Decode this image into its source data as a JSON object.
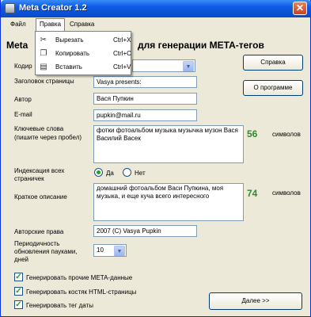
{
  "window": {
    "title": "Meta Creator 1.2",
    "close_glyph": "✕"
  },
  "menubar": {
    "items": [
      "Файл",
      "Правка",
      "Справка"
    ]
  },
  "edit_menu": {
    "items": [
      {
        "label": "Вырезать",
        "shortcut": "Ctrl+X",
        "icon": "scissors-icon"
      },
      {
        "label": "Копировать",
        "shortcut": "Ctrl+C",
        "icon": "copy-icon"
      },
      {
        "label": "Вставить",
        "shortcut": "Ctrl+V",
        "icon": "paste-icon"
      }
    ]
  },
  "heading": {
    "left": "Meta",
    "right": "для генерации META-тегов"
  },
  "side_buttons": {
    "help": "Справка",
    "about": "О программе",
    "next": "Далее >>"
  },
  "form": {
    "encoding": {
      "label": "Кодир"
    },
    "title": {
      "label": "Заголовок страницы",
      "value": "Vasya presents:"
    },
    "author": {
      "label": "Автор",
      "value": "Вася Пупкин"
    },
    "email": {
      "label": "E-mail",
      "value": "pupkin@mail.ru"
    },
    "keywords": {
      "label_line1": "Ключевые слова",
      "label_line2": "(пишите через пробел)",
      "value": "фотки фотоальбом музыка музычка музон Вася Василий Васек",
      "count": "56",
      "unit": "символов"
    },
    "indexing": {
      "label_line1": "Индексация всех",
      "label_line2": "страничек",
      "yes": "Да",
      "no": "Нет",
      "selected": "Да"
    },
    "description": {
      "label": "Краткое описание",
      "value": "домашний фотоальбом Васи Пупкина, моя музыка, и еще куча всего интересного",
      "count": "74",
      "unit": "символов"
    },
    "copyright": {
      "label": "Авторские права",
      "value": "2007 (C) Vasya Pupkin"
    },
    "revisit": {
      "label_line1": "Периодичность",
      "label_line2": "обновления пауками,",
      "label_line3": "дней",
      "value": "10"
    },
    "checkboxes": [
      {
        "label": "Генерировать прочие META-данные",
        "checked": true
      },
      {
        "label": "Генерировать костяк HTML-страницы",
        "checked": true
      },
      {
        "label": "Генерировать тег даты",
        "checked": true
      }
    ]
  },
  "check_glyph": "✓",
  "combo_glyph": "▼"
}
